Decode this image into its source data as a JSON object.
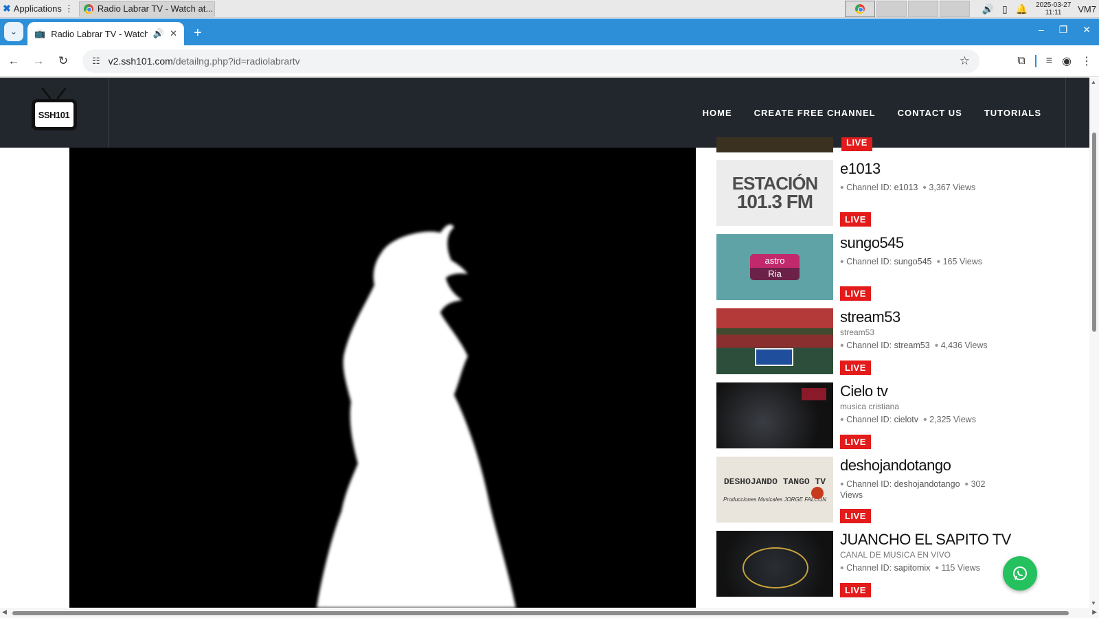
{
  "os": {
    "applications_label": "Applications",
    "taskbar_window": "Radio Labrar TV - Watch at...",
    "clock_date": "2025-03-27",
    "clock_time": "11:11",
    "host": "VM7"
  },
  "browser": {
    "tab_title": "Radio Labrar TV - Watch",
    "url_host": "v2.ssh101.com",
    "url_path": "/detailng.php?id=radiolabrartv"
  },
  "site": {
    "logo_text": "SSH101",
    "nav": [
      "HOME",
      "CREATE FREE CHANNEL",
      "CONTACT US",
      "TUTORIALS"
    ]
  },
  "sidebar": {
    "live_label": "LIVE",
    "channel_id_label": "Channel ID:",
    "views_label": "Views",
    "channels": [
      {
        "title": "e1013",
        "description": "",
        "channel_id": "e1013",
        "views": "3,367"
      },
      {
        "title": "sungo545",
        "description": "",
        "channel_id": "sungo545",
        "views": "165"
      },
      {
        "title": "stream53",
        "description": "stream53",
        "channel_id": "stream53",
        "views": "4,436"
      },
      {
        "title": "Cielo tv",
        "description": "musica cristiana",
        "channel_id": "cielotv",
        "views": "2,325"
      },
      {
        "title": "deshojandotango",
        "description": "",
        "channel_id": "deshojandotango",
        "views": "302"
      },
      {
        "title": "JUANCHO EL SAPITO TV",
        "description": "CANAL DE MUSICA EN VIVO",
        "channel_id": "sapitomix",
        "views": "115"
      }
    ],
    "thumbs": {
      "estacion_l1": "ESTACIÓN",
      "estacion_l2": "101.3 FM",
      "astro_l1": "astro",
      "astro_l2": "Ria",
      "tango_l1": "DESHOJANDO TANGO TV",
      "tango_l2": "Producciones Musicales JORGE FALCON"
    }
  },
  "icons": {
    "whatsapp": "whatsapp-icon",
    "accent": "#2d8fd8",
    "live_color": "#e31b1b",
    "header_bg": "#22272d"
  }
}
